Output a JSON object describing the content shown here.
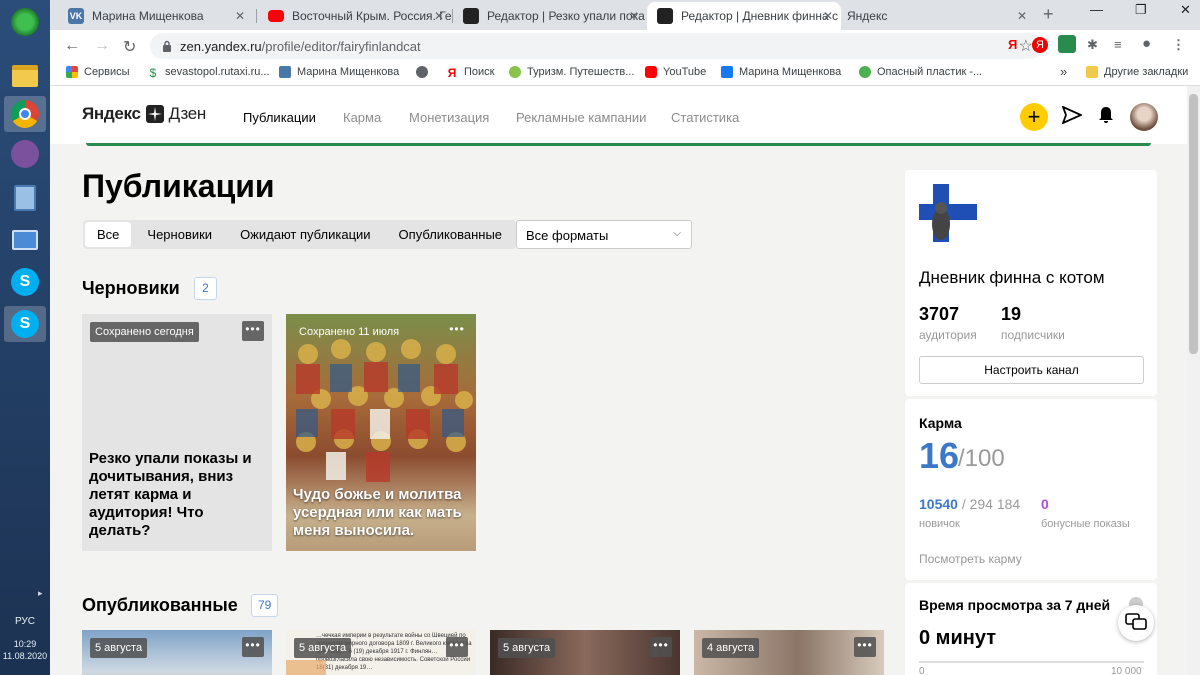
{
  "taskbar": {
    "lang": "РУС",
    "time": "10:29",
    "date": "11.08.2020",
    "icons": [
      "clover-icon",
      "folder-icon",
      "chrome-icon",
      "viber-icon",
      "calculator-icon",
      "network-icon",
      "skype-icon",
      "skype-business-icon"
    ]
  },
  "tabs": [
    {
      "title": "Марина Мищенкова",
      "icon": "vk-icon",
      "color": "#4a76a8"
    },
    {
      "title": "Восточный Крым. Россия. Ге",
      "icon": "youtube-icon",
      "color": "#ff0000"
    },
    {
      "title": "Редактор | Резко упали пока",
      "icon": "zen-icon",
      "color": "#222222"
    },
    {
      "title": "Редактор | Дневник финна с",
      "icon": "zen-icon",
      "color": "#222222"
    },
    {
      "title": "Яндекс",
      "icon": "yandex-icon",
      "color": "#ffffff"
    }
  ],
  "address": {
    "url_host": "zen.yandex.ru",
    "url_path": "/profile/editor/fairyfinlandcat"
  },
  "bookmarks": [
    {
      "label": "Сервисы",
      "icon": "apps-icon"
    },
    {
      "label": "sevastopol.rutaxi.ru...",
      "icon": "dollar-icon"
    },
    {
      "label": "Марина Мищенкова",
      "icon": "vk-icon"
    },
    {
      "label": "",
      "icon": "globe-icon"
    },
    {
      "label": "Поиск",
      "icon": "yandex-icon"
    },
    {
      "label": "Туризм. Путешеств...",
      "icon": "tourism-icon"
    },
    {
      "label": "YouTube",
      "icon": "youtube-icon"
    },
    {
      "label": "Марина Мищенкова",
      "icon": "facebook-icon"
    },
    {
      "label": "Опасный пластик -...",
      "icon": "leaf-icon"
    },
    {
      "label": "»",
      "icon": ""
    },
    {
      "label": "Другие закладки",
      "icon": "folder-icon"
    }
  ],
  "header": {
    "logo_left": "Яндекс",
    "logo_right": "Дзен",
    "nav": [
      "Публикации",
      "Карма",
      "Монетизация",
      "Рекламные кампании",
      "Статистика"
    ]
  },
  "main": {
    "title": "Публикации",
    "filters": [
      "Все",
      "Черновики",
      "Ожидают публикации",
      "Опубликованные"
    ],
    "format_select": "Все форматы",
    "drafts": {
      "title": "Черновики",
      "count": "2",
      "cards": [
        {
          "label": "Сохранено сегодня",
          "title": "Резко упали показы и дочитывания, вниз летят карма и аудитория! Что делать?"
        },
        {
          "label": "Сохранено 11 июля",
          "title": "Чудо божье и молитва усердная или как мать меня выносила."
        }
      ]
    },
    "published": {
      "title": "Опубликованные",
      "count": "79",
      "cards": [
        {
          "label": "5 августа"
        },
        {
          "label": "5 августа"
        },
        {
          "label": "5 августа"
        },
        {
          "label": "4 августа"
        }
      ],
      "card2_text": "…чечкая империи в результате войны со Швецией по условиям мирного договора 1809 г. Великого княжества Финлянд… 6 (19) декабря 1917 г. Финлян… провозгласила свою независимость. Советской России 18(31) декабря 19…"
    }
  },
  "channel": {
    "name": "Дневник финна с котом",
    "audience": "3707",
    "audience_label": "аудитория",
    "subscribers": "19",
    "subscribers_label": "подписчики",
    "setup_button": "Настроить канал"
  },
  "karma": {
    "title": "Карма",
    "value": "16",
    "max": "/100",
    "progress": "10540",
    "progress_total": "/ 294 184",
    "progress_label": "новичок",
    "bonus": "0",
    "bonus_label": "бонусные показы",
    "link": "Посмотреть карму"
  },
  "watch": {
    "title": "Время просмотра за 7 дней",
    "value": "0 минут",
    "min": "0",
    "max": "10 000"
  }
}
